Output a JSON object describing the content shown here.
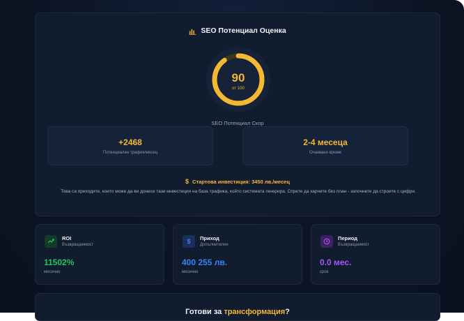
{
  "assessment": {
    "title": "SEO Потенциал Оценка",
    "title_icon": "bar-chart-icon",
    "score": {
      "value": "90",
      "max_label": "от 100",
      "fraction": 0.9,
      "caption": "SEO Потенциал Скор"
    },
    "stats": [
      {
        "value": "+2468",
        "label": "Потенциален трафик/месец"
      },
      {
        "value": "2-4 месеца",
        "label": "Очаквано време"
      }
    ],
    "investment": "Стартова инвестиция: 3450 лв./месец",
    "investment_icon": "dollar-icon",
    "description": "Това са приходите, които може да ви донесе тази инвестиция на база трафика, който системата генерира. Спрете да харчите без план - започнете да строите с цифри."
  },
  "metrics": [
    {
      "title": "ROI",
      "subtitle": "Възвращаемост",
      "value": "11502%",
      "note": "месечно",
      "icon": "trending-up-icon",
      "color": "#22c55e",
      "icon_bg": "#143a2c"
    },
    {
      "title": "Приход",
      "subtitle": "Допълнителен",
      "value": "400 255 лв.",
      "note": "месечно",
      "icon": "dollar-icon",
      "color": "#3b82f6",
      "icon_bg": "#1a2f5c"
    },
    {
      "title": "Период",
      "subtitle": "Възвращаемост",
      "value": "0.0 мес.",
      "note": "срок",
      "icon": "clock-icon",
      "color": "#a855f7",
      "icon_bg": "#3a2160"
    }
  ],
  "cta": {
    "title_prefix": "Готови за ",
    "title_accent": "трансформация",
    "title_suffix": "?"
  },
  "colors": {
    "accent": "#f5b833",
    "background": "#0c1424",
    "card": "#111c2e"
  }
}
